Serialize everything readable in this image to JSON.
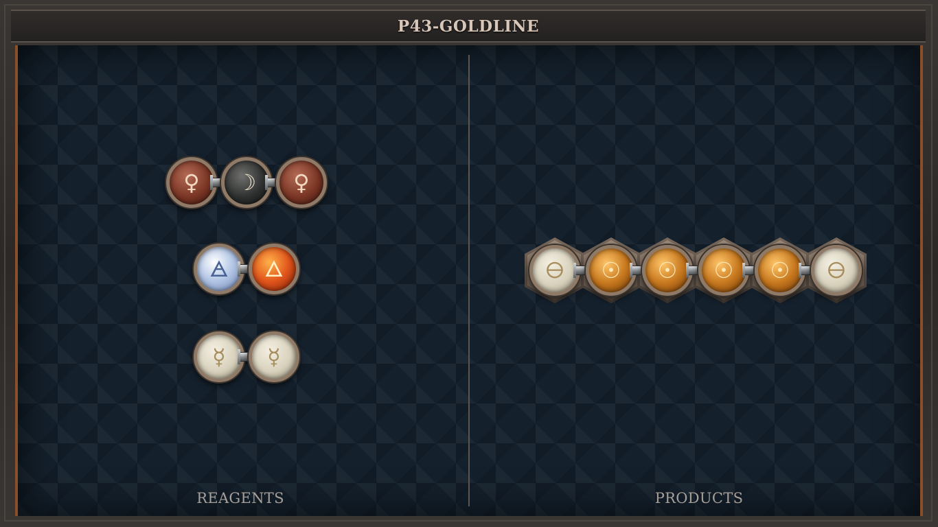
{
  "title": "P43-GOLDLINE",
  "reagents_label": "REAGENTS",
  "products_label": "PRODUCTS",
  "reagents": [
    {
      "atoms": [
        {
          "element": "copper",
          "glyph": "♀"
        },
        {
          "element": "silver",
          "glyph": "☽"
        },
        {
          "element": "copper",
          "glyph": "♀"
        }
      ]
    },
    {
      "atoms": [
        {
          "element": "air",
          "glyph": "🜁"
        },
        {
          "element": "fire",
          "glyph": "🜂"
        }
      ]
    },
    {
      "atoms": [
        {
          "element": "quicksilver",
          "glyph": "☿"
        },
        {
          "element": "quicksilver",
          "glyph": "☿"
        }
      ]
    }
  ],
  "products": [
    {
      "atoms": [
        {
          "element": "salt",
          "glyph": "🜔"
        },
        {
          "element": "gold",
          "glyph": "☉"
        },
        {
          "element": "gold",
          "glyph": "☉"
        },
        {
          "element": "gold",
          "glyph": "☉"
        },
        {
          "element": "gold",
          "glyph": "☉"
        },
        {
          "element": "salt",
          "glyph": "🜔"
        }
      ]
    }
  ],
  "colors": {
    "board": "#14202c",
    "accent_copper_border": "#8a4e28",
    "title_text": "#d8c7b8",
    "label_text": "#a7a09a"
  }
}
